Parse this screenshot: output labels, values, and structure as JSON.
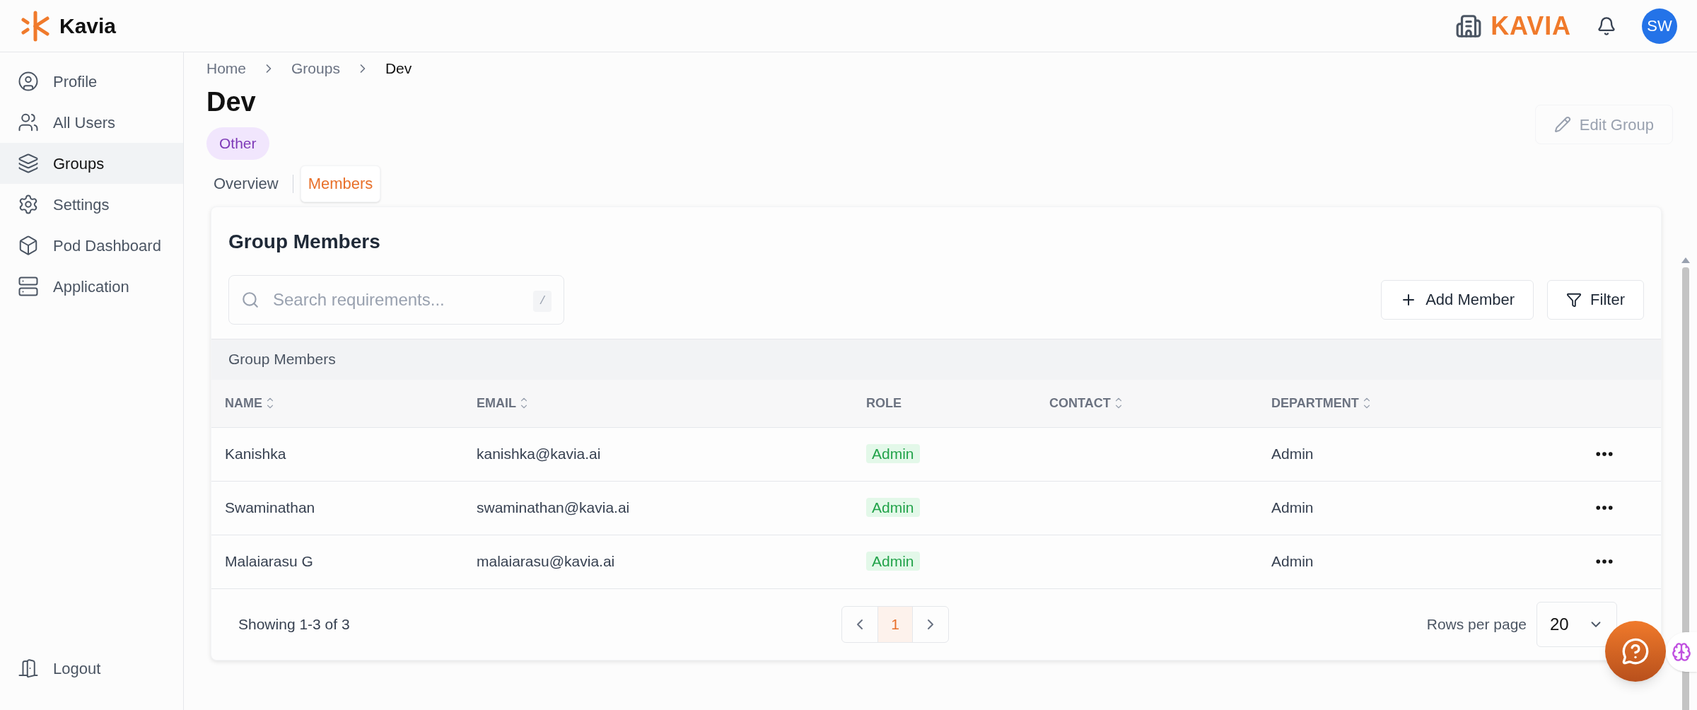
{
  "brand": {
    "name": "Kavia",
    "org": "KAVIA",
    "avatar": "SW"
  },
  "sidebar": {
    "items": [
      {
        "label": "Profile",
        "selected": false
      },
      {
        "label": "All Users",
        "selected": false
      },
      {
        "label": "Groups",
        "selected": true
      },
      {
        "label": "Settings",
        "selected": false
      },
      {
        "label": "Pod Dashboard",
        "selected": false
      },
      {
        "label": "Application",
        "selected": false
      }
    ],
    "logout": "Logout"
  },
  "breadcrumb": [
    "Home",
    "Groups",
    "Dev"
  ],
  "page": {
    "title": "Dev",
    "tag": "Other",
    "edit_button": "Edit Group"
  },
  "tabs": [
    {
      "label": "Overview",
      "selected": false
    },
    {
      "label": "Members",
      "selected": true
    }
  ],
  "card": {
    "title": "Group Members",
    "search": {
      "placeholder": "Search requirements...",
      "shortcut": "/"
    },
    "add_button": "Add Member",
    "filter_button": "Filter"
  },
  "table": {
    "caption": "Group Members",
    "columns": [
      {
        "label": "NAME",
        "sortable": true
      },
      {
        "label": "EMAIL",
        "sortable": true
      },
      {
        "label": "ROLE",
        "sortable": false
      },
      {
        "label": "CONTACT",
        "sortable": true
      },
      {
        "label": "DEPARTMENT",
        "sortable": true
      }
    ],
    "rows": [
      {
        "name": "Kanishka",
        "email": "kanishka@kavia.ai",
        "role": "Admin",
        "department": "Admin"
      },
      {
        "name": "Swaminathan",
        "email": "swaminathan@kavia.ai",
        "role": "Admin",
        "department": "Admin"
      },
      {
        "name": "Malaiarasu G",
        "email": "malaiarasu@kavia.ai",
        "role": "Admin",
        "department": "Admin"
      }
    ]
  },
  "pagination": {
    "summary": "Showing 1-3 of 3",
    "pages": [
      {
        "label": "1",
        "selected": true
      }
    ],
    "rows_label": "Rows per page",
    "rows_value": "20"
  }
}
